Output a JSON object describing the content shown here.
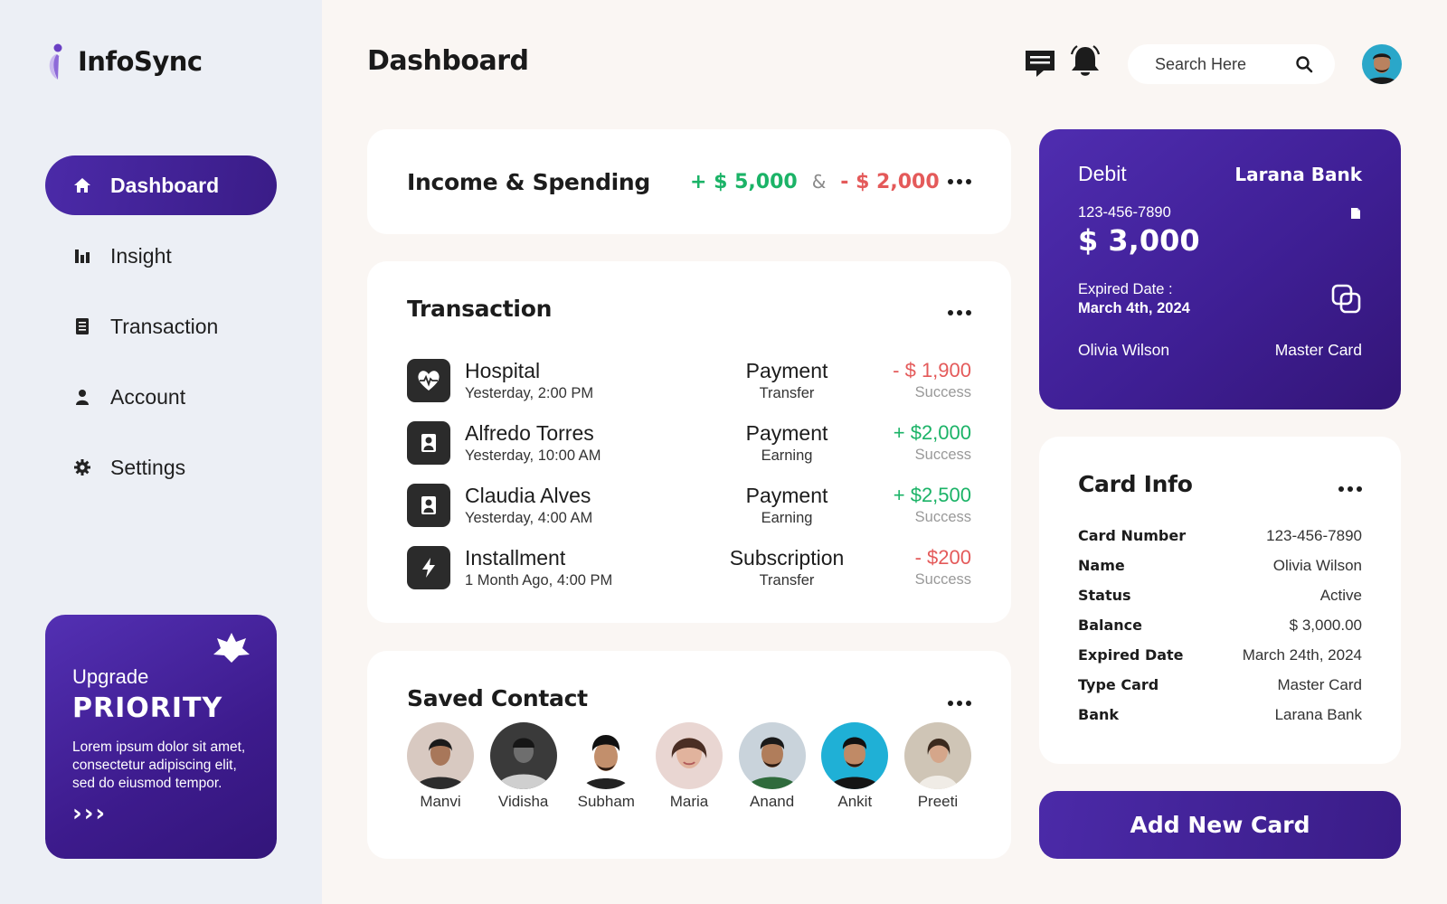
{
  "app": {
    "name": "InfoSync"
  },
  "sidebar": {
    "items": [
      {
        "label": "Dashboard",
        "icon": "home-icon",
        "active": true
      },
      {
        "label": "Insight",
        "icon": "bar-chart-icon"
      },
      {
        "label": "Transaction",
        "icon": "receipt-icon"
      },
      {
        "label": "Account",
        "icon": "user-icon"
      },
      {
        "label": "Settings",
        "icon": "gear-icon"
      }
    ],
    "upgrade": {
      "small": "Upgrade",
      "big": "PRIORITY",
      "desc": "Lorem ipsum dolor sit amet, consectetur  adipiscing  elit, sed do eiusmod tempor.",
      "arrows": "›››"
    }
  },
  "header": {
    "title": "Dashboard",
    "search_placeholder": "Search Here"
  },
  "income": {
    "title": "Income & Spending",
    "income": "+ $ 5,000",
    "separator": "&",
    "spending": "- $ 2,000"
  },
  "transactions": {
    "title": "Transaction",
    "rows": [
      {
        "name": "Hospital",
        "date": "Yesterday, 2:00 PM",
        "type": "Payment",
        "subtype": "Transfer",
        "amount": "- $ 1,900",
        "status": "Success",
        "icon": "heartbeat-icon",
        "sign": "neg"
      },
      {
        "name": "Alfredo Torres",
        "date": "Yesterday, 10:00 AM",
        "type": "Payment",
        "subtype": "Earning",
        "amount": "+ $2,000",
        "status": "Success",
        "icon": "user-icon",
        "sign": "pos"
      },
      {
        "name": "Claudia Alves",
        "date": "Yesterday, 4:00 AM",
        "type": "Payment",
        "subtype": "Earning",
        "amount": "+ $2,500",
        "status": "Success",
        "icon": "user-icon",
        "sign": "pos"
      },
      {
        "name": "Installment",
        "date": "1 Month Ago, 4:00 PM",
        "type": "Subscription",
        "subtype": "Transfer",
        "amount": "- $200",
        "status": "Success",
        "icon": "lightning-icon",
        "sign": "neg"
      }
    ]
  },
  "contacts": {
    "title": "Saved Contact",
    "people": [
      "Manvi",
      "Vidisha",
      "Subham",
      "Maria",
      "Anand",
      "Ankit",
      "Preeti"
    ]
  },
  "debit_card": {
    "label": "Debit",
    "bank": "Larana Bank",
    "number": "123-456-7890",
    "amount": "$ 3,000",
    "exp_label": "Expired Date :",
    "exp_value": "March 4th, 2024",
    "holder": "Olivia Wilson",
    "network": "Master Card"
  },
  "card_info": {
    "title": "Card Info",
    "rows": [
      {
        "k": "Card Number",
        "v": "123-456-7890"
      },
      {
        "k": "Name",
        "v": "Olivia Wilson"
      },
      {
        "k": "Status",
        "v": "Active"
      },
      {
        "k": "Balance",
        "v": "$ 3,000.00"
      },
      {
        "k": "Expired Date",
        "v": "March 24th, 2024"
      },
      {
        "k": "Type Card",
        "v": "Master Card"
      },
      {
        "k": "Bank",
        "v": "Larana Bank"
      }
    ]
  },
  "add_button": "Add New Card",
  "colors": {
    "accent": "#4b2aa8",
    "positive": "#1bb367",
    "negative": "#e45a5a"
  }
}
